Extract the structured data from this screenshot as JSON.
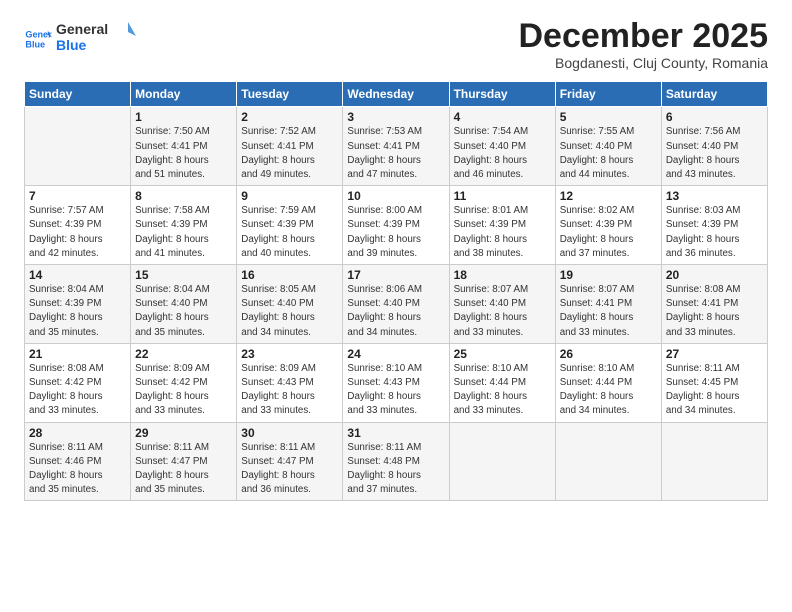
{
  "header": {
    "logo_line1": "General",
    "logo_line2": "Blue",
    "month": "December 2025",
    "location": "Bogdanesti, Cluj County, Romania"
  },
  "weekdays": [
    "Sunday",
    "Monday",
    "Tuesday",
    "Wednesday",
    "Thursday",
    "Friday",
    "Saturday"
  ],
  "weeks": [
    [
      {
        "day": "",
        "info": ""
      },
      {
        "day": "1",
        "info": "Sunrise: 7:50 AM\nSunset: 4:41 PM\nDaylight: 8 hours\nand 51 minutes."
      },
      {
        "day": "2",
        "info": "Sunrise: 7:52 AM\nSunset: 4:41 PM\nDaylight: 8 hours\nand 49 minutes."
      },
      {
        "day": "3",
        "info": "Sunrise: 7:53 AM\nSunset: 4:41 PM\nDaylight: 8 hours\nand 47 minutes."
      },
      {
        "day": "4",
        "info": "Sunrise: 7:54 AM\nSunset: 4:40 PM\nDaylight: 8 hours\nand 46 minutes."
      },
      {
        "day": "5",
        "info": "Sunrise: 7:55 AM\nSunset: 4:40 PM\nDaylight: 8 hours\nand 44 minutes."
      },
      {
        "day": "6",
        "info": "Sunrise: 7:56 AM\nSunset: 4:40 PM\nDaylight: 8 hours\nand 43 minutes."
      }
    ],
    [
      {
        "day": "7",
        "info": "Sunrise: 7:57 AM\nSunset: 4:39 PM\nDaylight: 8 hours\nand 42 minutes."
      },
      {
        "day": "8",
        "info": "Sunrise: 7:58 AM\nSunset: 4:39 PM\nDaylight: 8 hours\nand 41 minutes."
      },
      {
        "day": "9",
        "info": "Sunrise: 7:59 AM\nSunset: 4:39 PM\nDaylight: 8 hours\nand 40 minutes."
      },
      {
        "day": "10",
        "info": "Sunrise: 8:00 AM\nSunset: 4:39 PM\nDaylight: 8 hours\nand 39 minutes."
      },
      {
        "day": "11",
        "info": "Sunrise: 8:01 AM\nSunset: 4:39 PM\nDaylight: 8 hours\nand 38 minutes."
      },
      {
        "day": "12",
        "info": "Sunrise: 8:02 AM\nSunset: 4:39 PM\nDaylight: 8 hours\nand 37 minutes."
      },
      {
        "day": "13",
        "info": "Sunrise: 8:03 AM\nSunset: 4:39 PM\nDaylight: 8 hours\nand 36 minutes."
      }
    ],
    [
      {
        "day": "14",
        "info": "Sunrise: 8:04 AM\nSunset: 4:39 PM\nDaylight: 8 hours\nand 35 minutes."
      },
      {
        "day": "15",
        "info": "Sunrise: 8:04 AM\nSunset: 4:40 PM\nDaylight: 8 hours\nand 35 minutes."
      },
      {
        "day": "16",
        "info": "Sunrise: 8:05 AM\nSunset: 4:40 PM\nDaylight: 8 hours\nand 34 minutes."
      },
      {
        "day": "17",
        "info": "Sunrise: 8:06 AM\nSunset: 4:40 PM\nDaylight: 8 hours\nand 34 minutes."
      },
      {
        "day": "18",
        "info": "Sunrise: 8:07 AM\nSunset: 4:40 PM\nDaylight: 8 hours\nand 33 minutes."
      },
      {
        "day": "19",
        "info": "Sunrise: 8:07 AM\nSunset: 4:41 PM\nDaylight: 8 hours\nand 33 minutes."
      },
      {
        "day": "20",
        "info": "Sunrise: 8:08 AM\nSunset: 4:41 PM\nDaylight: 8 hours\nand 33 minutes."
      }
    ],
    [
      {
        "day": "21",
        "info": "Sunrise: 8:08 AM\nSunset: 4:42 PM\nDaylight: 8 hours\nand 33 minutes."
      },
      {
        "day": "22",
        "info": "Sunrise: 8:09 AM\nSunset: 4:42 PM\nDaylight: 8 hours\nand 33 minutes."
      },
      {
        "day": "23",
        "info": "Sunrise: 8:09 AM\nSunset: 4:43 PM\nDaylight: 8 hours\nand 33 minutes."
      },
      {
        "day": "24",
        "info": "Sunrise: 8:10 AM\nSunset: 4:43 PM\nDaylight: 8 hours\nand 33 minutes."
      },
      {
        "day": "25",
        "info": "Sunrise: 8:10 AM\nSunset: 4:44 PM\nDaylight: 8 hours\nand 33 minutes."
      },
      {
        "day": "26",
        "info": "Sunrise: 8:10 AM\nSunset: 4:44 PM\nDaylight: 8 hours\nand 34 minutes."
      },
      {
        "day": "27",
        "info": "Sunrise: 8:11 AM\nSunset: 4:45 PM\nDaylight: 8 hours\nand 34 minutes."
      }
    ],
    [
      {
        "day": "28",
        "info": "Sunrise: 8:11 AM\nSunset: 4:46 PM\nDaylight: 8 hours\nand 35 minutes."
      },
      {
        "day": "29",
        "info": "Sunrise: 8:11 AM\nSunset: 4:47 PM\nDaylight: 8 hours\nand 35 minutes."
      },
      {
        "day": "30",
        "info": "Sunrise: 8:11 AM\nSunset: 4:47 PM\nDaylight: 8 hours\nand 36 minutes."
      },
      {
        "day": "31",
        "info": "Sunrise: 8:11 AM\nSunset: 4:48 PM\nDaylight: 8 hours\nand 37 minutes."
      },
      {
        "day": "",
        "info": ""
      },
      {
        "day": "",
        "info": ""
      },
      {
        "day": "",
        "info": ""
      }
    ]
  ]
}
